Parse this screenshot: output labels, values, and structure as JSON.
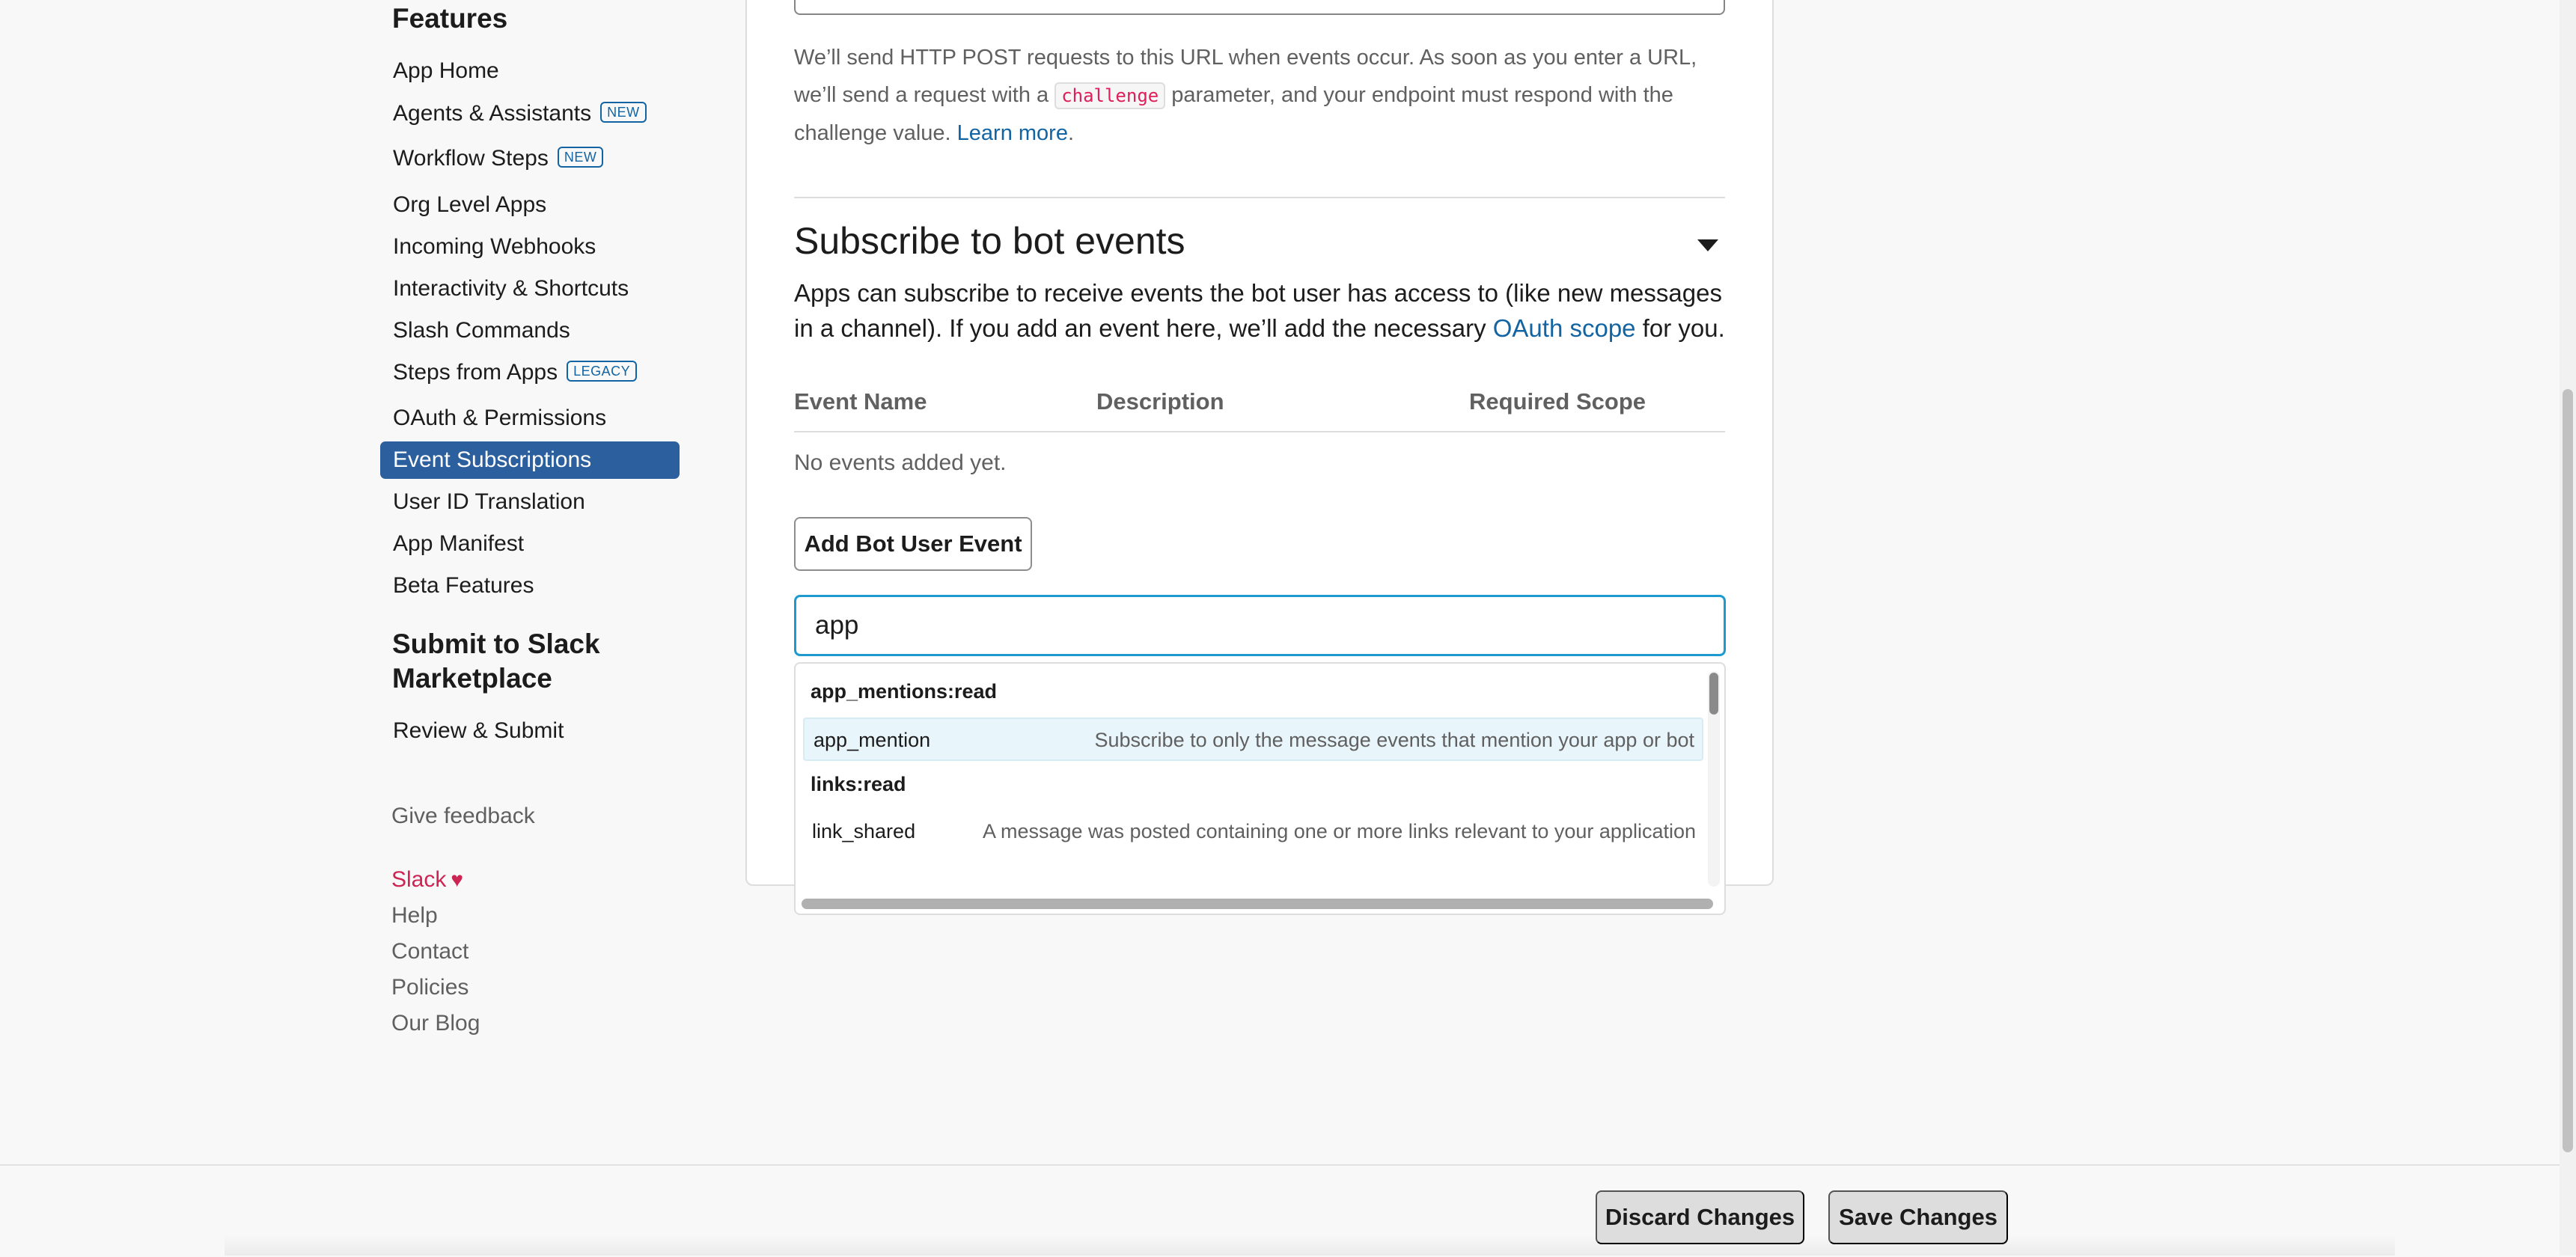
{
  "sidebar": {
    "features_heading": "Features",
    "items": [
      {
        "label": "App Home"
      },
      {
        "label": "Agents & Assistants",
        "badge": "NEW"
      },
      {
        "label": "Workflow Steps",
        "badge": "NEW"
      },
      {
        "label": "Org Level Apps"
      },
      {
        "label": "Incoming Webhooks"
      },
      {
        "label": "Interactivity & Shortcuts"
      },
      {
        "label": "Slash Commands"
      },
      {
        "label": "Steps from Apps",
        "badge": "LEGACY"
      },
      {
        "label": "OAuth & Permissions"
      },
      {
        "label": "Event Subscriptions",
        "active": true
      },
      {
        "label": "User ID Translation"
      },
      {
        "label": "App Manifest"
      },
      {
        "label": "Beta Features"
      }
    ],
    "submit_heading_line1": "Submit to Slack",
    "submit_heading_line2": "Marketplace",
    "review_submit": "Review & Submit",
    "give_feedback": "Give feedback",
    "footer_links": {
      "slack": "Slack",
      "help": "Help",
      "contact": "Contact",
      "policies": "Policies",
      "blog": "Our Blog"
    }
  },
  "request_url": {
    "desc_part1": "We’ll send HTTP POST requests to this URL when events occur. As soon as you enter a URL, we’ll send a request with a ",
    "code": "challenge",
    "desc_part2": " parameter, and your endpoint must respond with the challenge value. ",
    "learn_more": "Learn more",
    "period": "."
  },
  "bot_events": {
    "heading": "Subscribe to bot events",
    "para_part1": "Apps can subscribe to receive events the bot user has access to (like new messages in a channel). If you add an event here, we’ll add the necessary ",
    "oauth_link": "OAuth scope",
    "para_part2": " for you.",
    "columns": {
      "name": "Event Name",
      "description": "Description",
      "scope": "Required Scope"
    },
    "empty": "No events added yet.",
    "add_button": "Add Bot User Event",
    "search_value": "app",
    "dropdown": [
      {
        "group": "app_mentions:read",
        "events": [
          {
            "name": "app_mention",
            "desc": "Subscribe to only the message events that mention your app or bot",
            "highlighted": true
          }
        ]
      },
      {
        "group": "links:read",
        "events": [
          {
            "name": "link_shared",
            "desc": "A message was posted containing one or more links relevant to your application",
            "highlighted": false
          }
        ]
      }
    ]
  },
  "footer": {
    "discard": "Discard Changes",
    "save": "Save Changes"
  },
  "colors": {
    "active_nav": "#2c5f9e",
    "link": "#1264a3",
    "code": "#e01e5a",
    "focus": "#1d9bd1",
    "slack_brand": "#cd2553"
  },
  "icons": {
    "collapse": "caret-down-icon",
    "heart": "heart-icon"
  }
}
